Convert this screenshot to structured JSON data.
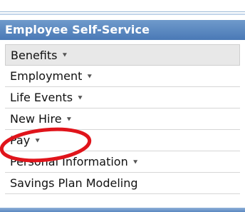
{
  "header": {
    "title": "Employee Self-Service"
  },
  "menu": {
    "items": [
      {
        "label": "Benefits",
        "has_dropdown": true,
        "selected": true
      },
      {
        "label": "Employment",
        "has_dropdown": true
      },
      {
        "label": "Life Events",
        "has_dropdown": true
      },
      {
        "label": "New Hire",
        "has_dropdown": true
      },
      {
        "label": "Pay",
        "has_dropdown": true,
        "highlighted": true
      },
      {
        "label": "Personal Information",
        "has_dropdown": true
      },
      {
        "label": "Savings Plan Modeling",
        "has_dropdown": false
      }
    ]
  },
  "icons": {
    "dropdown": "chevron-down-icon",
    "annotation": "red-ellipse-highlight"
  },
  "colors": {
    "header_bg": "#5b88c0",
    "header_text": "#ffffff",
    "highlight_ring": "#e0141b"
  }
}
